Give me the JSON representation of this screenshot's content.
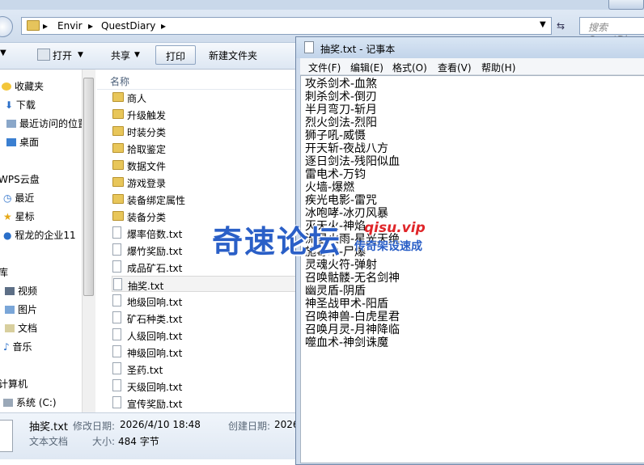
{
  "address": {
    "crumbs": [
      "Envir",
      "QuestDiary"
    ],
    "search_placeholder": "搜索 QuestDiary"
  },
  "toolbar": {
    "open": "打开",
    "share": "共享",
    "print": "打印",
    "new_folder": "新建文件夹"
  },
  "nav": {
    "items": [
      "收藏夹",
      "下载",
      "最近访问的位置",
      "桌面",
      "WPS云盘",
      "最近",
      "星标",
      "程龙的企业11",
      "库",
      "视频",
      "图片",
      "文档",
      "音乐",
      "计算机",
      "系统 (C:)"
    ]
  },
  "files": {
    "column": "名称",
    "folders": [
      "商人",
      "升级触发",
      "时装分类",
      "拾取鉴定",
      "数据文件",
      "游戏登录",
      "装备绑定属性",
      "装备分类"
    ],
    "texts": [
      "爆率倍数.txt",
      "爆竹奖励.txt",
      "成品矿石.txt",
      "抽奖.txt",
      "地级回响.txt",
      "矿石种类.txt",
      "人级回响.txt",
      "神级回响.txt",
      "圣药.txt",
      "天级回响.txt",
      "宣传奖励.txt"
    ]
  },
  "details": {
    "name": "抽奖.txt",
    "modified_label": "修改日期:",
    "modified_value": "2026/4/10 18:48",
    "created_label": "创建日期:",
    "created_value": "2026",
    "type": "文本文档",
    "size_label": "大小:",
    "size_value": "484 字节"
  },
  "notepad": {
    "title": "抽奖.txt - 记事本",
    "menu": [
      "文件(F)",
      "编辑(E)",
      "格式(O)",
      "查看(V)",
      "帮助(H)"
    ],
    "lines": [
      "攻杀剑术-血煞",
      "刺杀剑术-倒刃",
      "半月弯刀-斩月",
      "烈火剑法-烈阳",
      "狮子吼-威慑",
      "开天斩-夜战八方",
      "逐日剑法-残阳似血",
      "雷电术-万钧",
      "火墙-爆燃",
      "疾光电影-雷咒",
      "冰咆哮-冰刃风暴",
      "灭天火-神焰",
      "流星火雨-星光天绝",
      "施毒术-尸爆",
      "灵魂火符-弹射",
      "召唤骷髅-无名剑神",
      "幽灵盾-阴盾",
      "神圣战甲术-阳盾",
      "召唤神兽-白虎星君",
      "召唤月灵-月神降临",
      "噬血术-神剑诛魔"
    ]
  },
  "watermark": {
    "main": "奇速论坛",
    "url": "qisu.vip",
    "slogan": "传奇架设速成"
  }
}
